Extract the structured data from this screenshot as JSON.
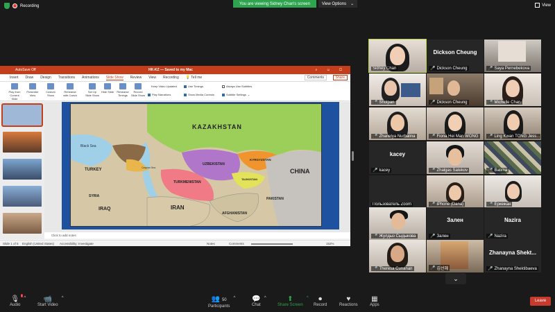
{
  "topbar": {
    "recording": "Recording",
    "banner": "You are viewing Sidney Chan's screen",
    "view_options": "View Options",
    "view": "View",
    "banner_color": "#2ea44f"
  },
  "ppt": {
    "autosave": "AutoSave",
    "autosave_state": "Off",
    "filename": "HK-KZ",
    "saved": "Saved to my Mac",
    "tell_me": "Tell me",
    "tabs": [
      "Insert",
      "Draw",
      "Design",
      "Transitions",
      "Animations",
      "Slide Show",
      "Review",
      "View",
      "Recording"
    ],
    "active_tab": "Slide Show",
    "comments": "Comments",
    "share": "Share",
    "ribbon": [
      {
        "label": "Play from Current Slide"
      },
      {
        "label": "Presenter View"
      },
      {
        "label": "Custom Show"
      },
      {
        "label": "Rehearse with Coach"
      },
      {
        "label": "Set Up Slide Show"
      },
      {
        "label": "Hide Slide"
      },
      {
        "label": "Rehearse Timings"
      },
      {
        "label": "Record Slide Show"
      }
    ],
    "options": {
      "keep_video": "Keep Video Updated",
      "use_timings": "Use Timings",
      "play_narrations": "Play Narrations",
      "show_media_controls": "Show Media Controls",
      "always_subtitles": "Always Use Subtitles",
      "subtitle_settings": "Subtitle Settings"
    },
    "map_labels": {
      "kazakhstan": "KAZAKHSTAN",
      "uzbekistan": "UZBEKISTAN",
      "turkmenistan": "TURKMENISTAN",
      "kyrgyzstan": "KYRGYZSTAN",
      "tajikistan": "TAJIKISTAN",
      "china": "CHINA",
      "iran": "IRAN",
      "iraq": "IRAQ",
      "turkey": "TURKEY",
      "afghanistan": "AFGHANISTAN",
      "pakistan": "PAKISTAN",
      "syria": "SYRIA",
      "black_sea": "Black Sea",
      "caspian": "Caspian Sea"
    },
    "notes_placeholder": "Click to add notes",
    "status": {
      "slide": "Slide 1 of 5",
      "language": "English (United States)",
      "accessibility": "Accessibility: Investigate",
      "notes": "Notes",
      "comments": "Comments",
      "zoom": "152%"
    }
  },
  "participants": [
    {
      "name": "Sidney Chan",
      "video": true,
      "muted": false
    },
    {
      "name": "Dickson Cheung",
      "video": false,
      "muted": true,
      "big": "Dickson Cheung"
    },
    {
      "name": "Saya Pernebekova",
      "video": true,
      "muted": true
    },
    {
      "name": "Sholpan",
      "video": true,
      "muted": true
    },
    {
      "name": "Dickson Cheung",
      "video": true,
      "muted": true
    },
    {
      "name": "Michelle Chan",
      "video": true,
      "muted": true
    },
    {
      "name": "Zhanelya Nurbalina",
      "video": true,
      "muted": true
    },
    {
      "name": "Fiona Hei Man WONG",
      "video": true,
      "muted": true
    },
    {
      "name": "Ling Kwan TONG Jess...",
      "video": true,
      "muted": true
    },
    {
      "name": "kacey",
      "video": false,
      "muted": true,
      "big": "kacey"
    },
    {
      "name": "Zhalgas Satekov",
      "video": true,
      "muted": true
    },
    {
      "name": "Batima",
      "video": true,
      "muted": true
    },
    {
      "name": "Пользователь Zoom",
      "video": false,
      "muted": false
    },
    {
      "name": "iPhone (Dana)",
      "video": true,
      "muted": true
    },
    {
      "name": "Еркежан",
      "video": true,
      "muted": true
    },
    {
      "name": "Жулдыз Сыдыкова",
      "video": true,
      "muted": true
    },
    {
      "name": "Зален",
      "video": false,
      "muted": true,
      "big": "Зален"
    },
    {
      "name": "Nazira",
      "video": false,
      "muted": true,
      "big": "Nazira"
    },
    {
      "name": "Theresa Cunanan",
      "video": true,
      "muted": true
    },
    {
      "name": "김선혜",
      "video": true,
      "muted": true
    },
    {
      "name": "Zhanayna Shektibaeva",
      "video": false,
      "muted": true,
      "big": "Zhanayna Shekt..."
    }
  ],
  "toolbar": {
    "audio": "Audio",
    "video": "Start Video",
    "participants": "Participants",
    "participant_count": "50",
    "chat": "Chat",
    "share_screen": "Share Screen",
    "record": "Record",
    "reactions": "Reactions",
    "apps": "Apps",
    "leave": "Leave",
    "leave_color": "#c73a2e"
  }
}
